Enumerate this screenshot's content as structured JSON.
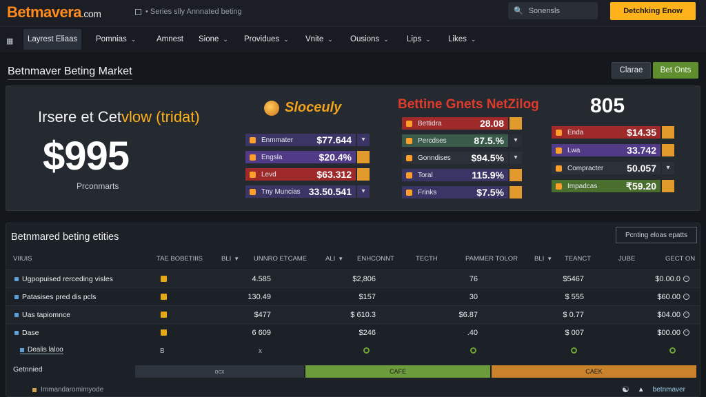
{
  "header": {
    "logo_main": "Betmavera",
    "logo_domain": ".com",
    "tagline": "• Series slly Annnated beting",
    "search_placeholder": "Sonensls",
    "cta_label": "Detchking Enow"
  },
  "nav": {
    "items": [
      {
        "label": "Layrest Eliaas",
        "chevron": false
      },
      {
        "label": "Pomnias",
        "chevron": true
      },
      {
        "label": "Amnest",
        "chevron": false
      },
      {
        "label": "Sione",
        "chevron": true
      },
      {
        "label": "Providues",
        "chevron": true
      },
      {
        "label": "Vnite",
        "chevron": true
      },
      {
        "label": "Ousions",
        "chevron": true
      },
      {
        "label": "Lips",
        "chevron": true
      },
      {
        "label": "Likes",
        "chevron": true
      }
    ]
  },
  "page": {
    "title": "Betnmaver Beting Market",
    "btn_clear": "Clarae",
    "btn_bet": "Bet Onts"
  },
  "hero": {
    "heading_pre": "Irsere et Cet",
    "heading_hl": "vlow (tridat)",
    "amount": "$995",
    "amount_sub": "Prconmarts",
    "brand_mid": "Sloceuly",
    "red_title": "Bettine Gnets NetZilog",
    "big_number": "805",
    "col1": [
      {
        "label": "Enmmater",
        "value": "$77.644",
        "color": "#3b3566",
        "tail": "#3b3566",
        "chev": true
      },
      {
        "label": "Engsla",
        "value": "$20.4%",
        "color": "#513a86",
        "tail": "#e29a2c",
        "chev": false
      },
      {
        "label": "Levd",
        "value": "$63.312",
        "color": "#9e2a2a",
        "tail": "#e29a2c",
        "chev": false
      },
      {
        "label": "Tny Muncias",
        "value": "33.50.541",
        "color": "#3b3566",
        "tail": "#3b3566",
        "chev": true
      }
    ],
    "col2": [
      {
        "label": "Bettidra",
        "value": "28.08",
        "color": "#9e2a2a",
        "tail": "#e29a2c",
        "chev": false
      },
      {
        "label": "Percdses",
        "value": "87.5.%",
        "color": "#3a5a4a",
        "tail": "#2a2f37",
        "chev": true
      },
      {
        "label": "Gonndises",
        "value": "$94.5%",
        "color": "#2b3039",
        "tail": "#2b3039",
        "chev": true
      },
      {
        "label": "Toral",
        "value": "115.9%",
        "color": "#3b3566",
        "tail": "#e29a2c",
        "chev": false
      },
      {
        "label": "Frinks",
        "value": "$7.5%",
        "color": "#3b3566",
        "tail": "#e29a2c",
        "chev": false
      }
    ],
    "col3": [
      {
        "label": "Enda",
        "value": "$14.35",
        "color": "#9e2a2a",
        "tail": "#e29a2c",
        "chev": false
      },
      {
        "label": "Lwa",
        "value": "33.742",
        "color": "#513a86",
        "tail": "#e29a2c",
        "chev": false
      },
      {
        "label": "Compracter",
        "value": "50.057",
        "color": "#2b3039",
        "tail": "#2b3039",
        "chev": true
      },
      {
        "label": "Impadcas",
        "value": "₹59.20",
        "color": "#4a6e2d",
        "tail": "#e29a2c",
        "chev": false
      }
    ]
  },
  "entities": {
    "title": "Betnmared beting etities",
    "filter_label": "Pcnting eloas epatts",
    "headers": [
      {
        "label": "VIIUIS",
        "chev": false
      },
      {
        "label": "TAE BOBETIIIS",
        "chev": false
      },
      {
        "label": "BLI",
        "chev": true
      },
      {
        "label": "UNNRO ETCAME",
        "chev": false
      },
      {
        "label": "ALI",
        "chev": true
      },
      {
        "label": "ENHCONNT",
        "chev": false
      },
      {
        "label": "TECTH",
        "chev": false
      },
      {
        "label": "PAMMER TOLOR",
        "chev": false
      },
      {
        "label": "BLI",
        "chev": true
      },
      {
        "label": "TEANCT",
        "chev": false
      },
      {
        "label": "JUBE",
        "chev": false
      },
      {
        "label": "GECT ON",
        "chev": false
      }
    ],
    "rows": [
      {
        "name": "Ugpopuised rerceding visles",
        "c1": "4.585",
        "c2": "$2,806",
        "c3": "76",
        "c4": "$5467",
        "c5": "$0.00.0"
      },
      {
        "name": "Patasises pred dis pcls",
        "c1": "130.49",
        "c2": "$157",
        "c3": "30",
        "c4": "$ 555",
        "c5": "$60.00"
      },
      {
        "name": "Uas tapiomnce",
        "c1": "$477",
        "c2": "$ 610.3",
        "c3": "$6.87",
        "c4": "$ 0.77",
        "c5": "$04.00"
      },
      {
        "name": "Dase",
        "c1": "6 609",
        "c2": "$246",
        "c3": ".40",
        "c4": "$ 007",
        "c5": "$00.00"
      }
    ],
    "detail_label": "Dealis laloo",
    "detail_b": "B",
    "detail_x": "x",
    "gen_label": "Getnnied",
    "seg1": "ocx",
    "seg2": "CAFE",
    "seg3": "CAEK",
    "footer_text": "Immandaromimyode",
    "footer_brand": "betnmaver"
  }
}
